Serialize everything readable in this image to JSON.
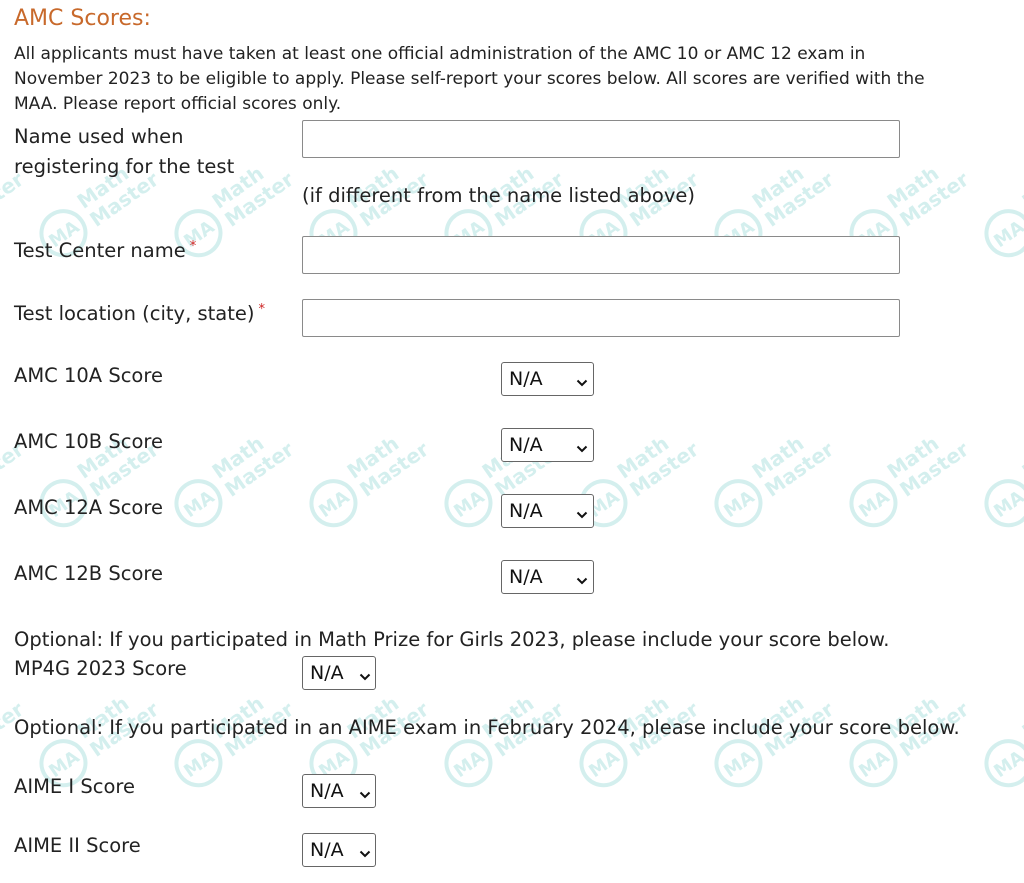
{
  "section": {
    "title": "AMC Scores:",
    "intro": "All applicants must have taken at least one official administration of the AMC 10 or AMC 12 exam in November 2023 to be eligible to apply. Please self-report your scores below. All scores are verified with the MAA. Please report official scores only."
  },
  "fields": {
    "registration_name": {
      "label": "Name used when registering for the test",
      "value": "",
      "hint": "(if different from the name listed above)"
    },
    "test_center": {
      "label": "Test Center name",
      "required_mark": "*",
      "value": ""
    },
    "test_location": {
      "label": "Test location (city, state)",
      "required_mark": "*",
      "value": ""
    }
  },
  "scores": {
    "amc10a": {
      "label": "AMC 10A Score",
      "selected": "N/A"
    },
    "amc10b": {
      "label": "AMC 10B Score",
      "selected": "N/A"
    },
    "amc12a": {
      "label": "AMC 12A Score",
      "selected": "N/A"
    },
    "amc12b": {
      "label": "AMC 12B Score",
      "selected": "N/A"
    }
  },
  "mp4g": {
    "note": "Optional: If you participated in Math Prize for Girls 2023, please include your score below.",
    "label": "MP4G 2023 Score",
    "selected": "N/A"
  },
  "aime": {
    "note": "Optional: If you participated in an AIME exam in February 2024, please include your score below.",
    "aime1": {
      "label": "AIME I Score",
      "selected": "N/A"
    },
    "aime2": {
      "label": "AIME II Score",
      "selected": "N/A"
    }
  },
  "watermark": {
    "line1": "Math",
    "line2": "Master",
    "glyph": "MA",
    "color": "#8fd6d4"
  },
  "colors": {
    "title": "#c8692b",
    "required": "#cc2222",
    "text": "#222222"
  },
  "icons": {
    "select_arrow": "chevron-down-icon"
  }
}
